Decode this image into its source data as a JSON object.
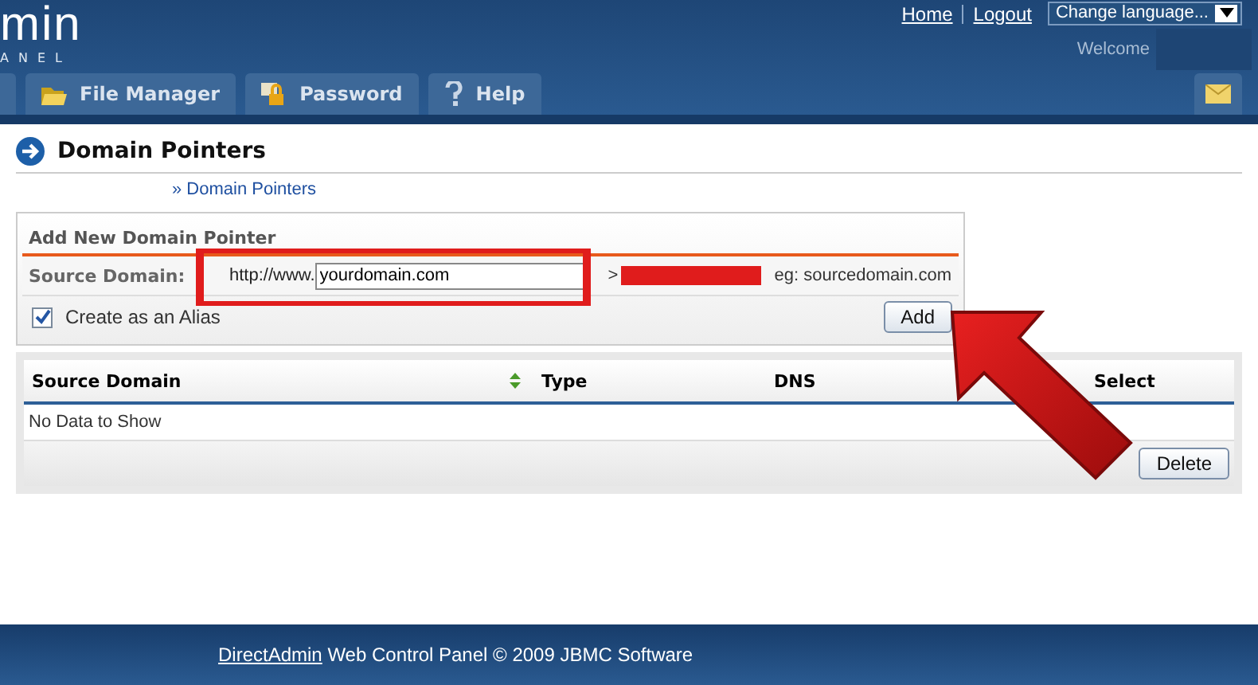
{
  "header": {
    "logo_text": "min",
    "logo_subtext": "ANEL",
    "links": [
      "Home",
      "Logout"
    ],
    "language_select": "Change language...",
    "welcome": "Welcome"
  },
  "tabs": [
    {
      "label": "File Manager",
      "selected": false
    },
    {
      "label": "Password",
      "selected": false
    },
    {
      "label": "Help",
      "selected": false
    }
  ],
  "page": {
    "title": "Domain Pointers",
    "breadcrumb": "» Domain Pointers"
  },
  "form": {
    "title": "Add New Domain Pointer",
    "label": "Source Domain:",
    "prefix": "http://www.",
    "value": "yourdomain.com",
    "separator": ">",
    "example": "eg: sourcedomain.com",
    "alias_label": "Create as an Alias",
    "alias_checked": true,
    "button": "Add"
  },
  "table": {
    "columns": [
      "Source Domain",
      "Type",
      "DNS",
      "Select"
    ],
    "empty": "No Data to Show",
    "button": "Delete"
  },
  "footer": {
    "link": "DirectAdmin",
    "text": "Web Control Panel © 2009 JBMC Software"
  }
}
